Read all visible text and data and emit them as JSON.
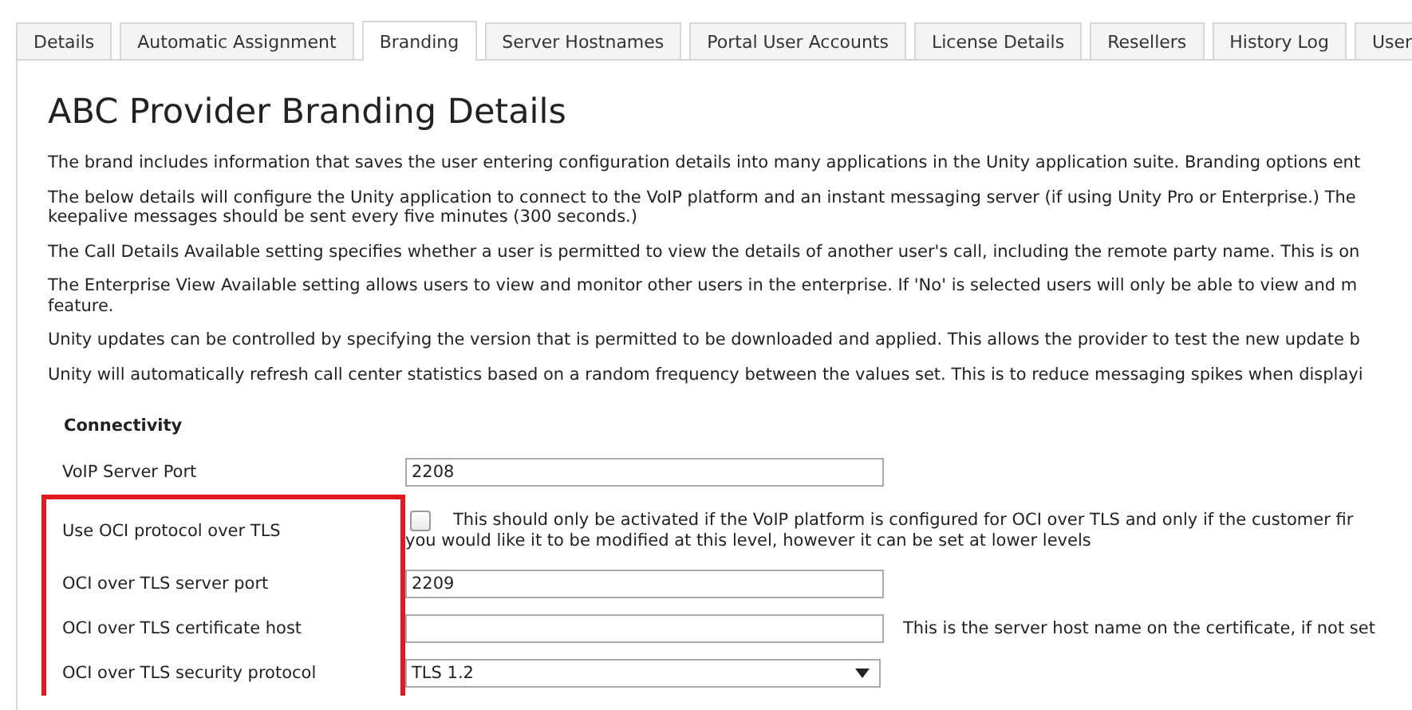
{
  "tabs": [
    {
      "label": "Details",
      "selected": false
    },
    {
      "label": "Automatic Assignment",
      "selected": false
    },
    {
      "label": "Branding",
      "selected": true
    },
    {
      "label": "Server Hostnames",
      "selected": false
    },
    {
      "label": "Portal User Accounts",
      "selected": false
    },
    {
      "label": "License Details",
      "selected": false
    },
    {
      "label": "Resellers",
      "selected": false
    },
    {
      "label": "History Log",
      "selected": false
    },
    {
      "label": "User",
      "selected": false
    }
  ],
  "title": "ABC Provider Branding Details",
  "paragraphs": [
    {
      "lines": [
        "The brand includes information that saves the user entering configuration details into many applications in the Unity application suite. Branding options ent"
      ]
    },
    {
      "lines": [
        "The below details will configure the Unity application to connect to the VoIP platform and an instant messaging server (if using Unity Pro or Enterprise.) The",
        "keepalive messages should be sent every five minutes (300 seconds.)"
      ]
    },
    {
      "lines": [
        "The Call Details Available setting specifies whether a user is permitted to view the details of another user's call, including the remote party name. This is on"
      ]
    },
    {
      "lines": [
        "The Enterprise View Available setting allows users to view and monitor other users in the enterprise. If 'No' is selected users will only be able to view and m",
        "feature."
      ]
    },
    {
      "lines": [
        "Unity updates can be controlled by specifying the version that is permitted to be downloaded and applied. This allows the provider to test the new update b"
      ]
    },
    {
      "lines": [
        "Unity will automatically refresh call center statistics based on a random frequency between the values set. This is to reduce messaging spikes when displayi"
      ]
    }
  ],
  "section": "Connectivity",
  "rows": [
    {
      "kind": "text",
      "label": "VoIP Server Port",
      "value": "2208",
      "highlighted": false
    },
    {
      "kind": "checkbox",
      "label": "Use OCI protocol over TLS",
      "checked": false,
      "note_lines": [
        "This should only be activated if the VoIP platform is configured for OCI over TLS and only if the customer fir",
        "you would like it to be modified at this level, however it can be set at lower levels"
      ],
      "highlighted": true
    },
    {
      "kind": "text",
      "label": "OCI over TLS server port",
      "value": "2209",
      "highlighted": true
    },
    {
      "kind": "text",
      "label": "OCI over TLS certificate host",
      "note": "This is the server host name on the certificate, if not set",
      "highlighted": true
    },
    {
      "kind": "select",
      "label": "OCI over TLS security protocol",
      "value": "TLS 1.2",
      "highlighted": true
    }
  ]
}
